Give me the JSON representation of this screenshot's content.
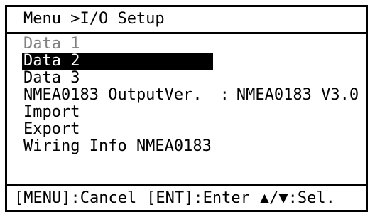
{
  "title": "Menu >I/O Setup",
  "menu": {
    "items": [
      {
        "label": "Data 1",
        "state": "disabled"
      },
      {
        "label": "Data 2",
        "state": "selected"
      },
      {
        "label": "Data 3",
        "state": "normal"
      },
      {
        "label": "NMEA0183 OutputVer.",
        "value": "NMEA0183 V3.0",
        "separator": ":"
      },
      {
        "label": "Import",
        "state": "normal"
      },
      {
        "label": "Export",
        "state": "normal"
      },
      {
        "label": "Wiring Info NMEA0183",
        "state": "normal"
      }
    ]
  },
  "help": {
    "cancel": "[MENU]:Cancel",
    "enter": "[ENT]:Enter",
    "select": "▲/▼:Sel."
  },
  "colors": {
    "border": "#000000",
    "selected_bg": "#000000",
    "selected_fg": "#ffffff",
    "disabled_fg": "#808080"
  }
}
